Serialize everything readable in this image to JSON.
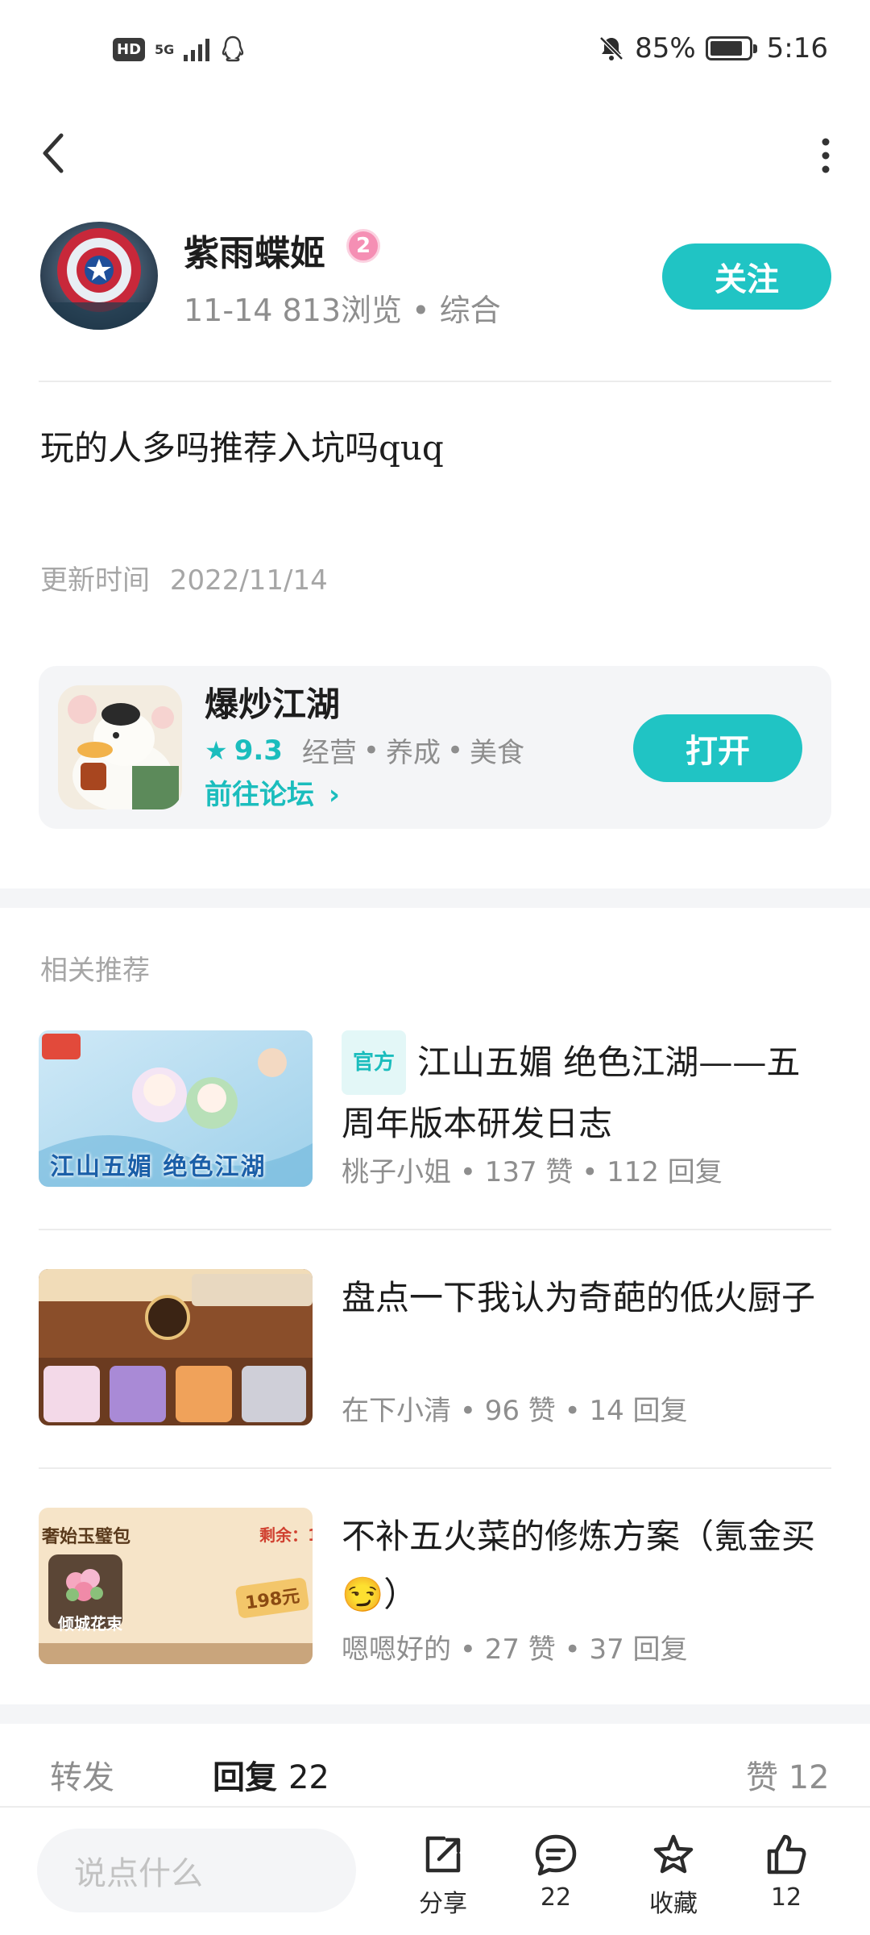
{
  "status": {
    "signal_label": "5G",
    "battery": "85%",
    "battery_level": 0.85,
    "time": "5:16"
  },
  "post": {
    "author": "紫雨蝶姬",
    "author_level": "2",
    "date": "11-14",
    "views": "813浏览",
    "category": "综合",
    "follow_label": "关注",
    "title": "玩的人多吗推荐入坑吗quq",
    "update_label": "更新时间",
    "update_date": "2022/11/14"
  },
  "game": {
    "name": "爆炒江湖",
    "rating": "9.3",
    "tags": [
      "经营",
      "养成",
      "美食"
    ],
    "forum_link": "前往论坛",
    "open_label": "打开"
  },
  "recommend": {
    "section_title": "相关推荐",
    "items": [
      {
        "tag": "官方",
        "title": "江山五媚 绝色江湖——五周年版本研发日志",
        "author": "桃子小姐",
        "likes": "137 赞",
        "replies": "112 回复",
        "thumb_text": "江山五媚 绝色江湖"
      },
      {
        "tag": "",
        "title": "盘点一下我认为奇葩的低火厨子",
        "author": "在下小清",
        "likes": "96 赞",
        "replies": "14 回复",
        "thumb_text": ""
      },
      {
        "tag": "",
        "title": "不补五火菜的修炼方案（氪金买😏）",
        "author": "嗯嗯好的",
        "likes": "27 赞",
        "replies": "37 回复",
        "thumb_text": "倾城花束",
        "thumb_price": "198元",
        "thumb_remaining": "剩余：1",
        "thumb_header": "奢始玉璧包"
      }
    ]
  },
  "tabs": {
    "forward": "转发",
    "reply": "回复",
    "reply_count": "22",
    "like": "赞",
    "like_count": "12"
  },
  "bottom": {
    "input_placeholder": "说点什么",
    "share_label": "分享",
    "comment_count": "22",
    "favorite_label": "收藏",
    "like_count": "12"
  }
}
